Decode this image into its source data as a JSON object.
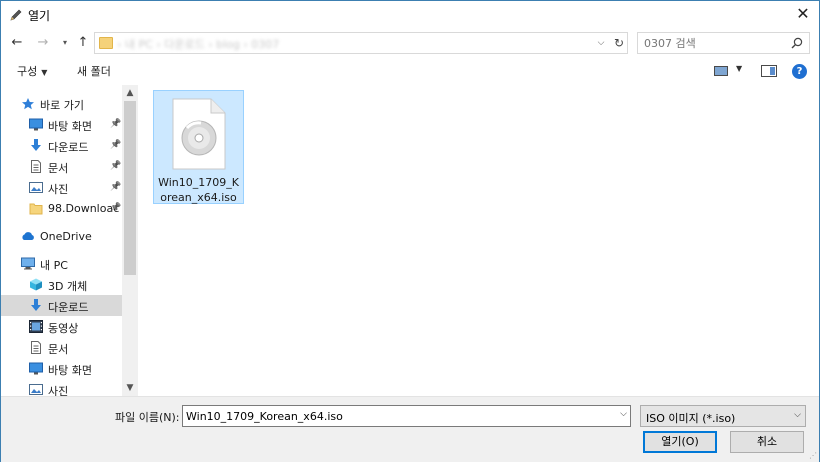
{
  "window": {
    "title": "열기"
  },
  "address": {
    "crumbs": "› 내 PC › 다운로드 › blog › 0307",
    "search_placeholder": "0307 검색"
  },
  "toolbar": {
    "organize_label": "구성",
    "new_folder_label": "새 폴더"
  },
  "nav": {
    "items": [
      {
        "label": "바로 가기",
        "icon": "star-icon",
        "pinned": false
      },
      {
        "label": "바탕 화면",
        "icon": "desktop-icon",
        "pinned": true
      },
      {
        "label": "다운로드",
        "icon": "download-icon",
        "pinned": true
      },
      {
        "label": "문서",
        "icon": "document-icon",
        "pinned": true
      },
      {
        "label": "사진",
        "icon": "pictures-icon",
        "pinned": true
      },
      {
        "label": "98.Downloac",
        "icon": "folder-icon",
        "pinned": true
      },
      {
        "label": "OneDrive",
        "icon": "cloud-icon",
        "pinned": false
      },
      {
        "label": "내 PC",
        "icon": "pc-icon",
        "pinned": false
      },
      {
        "label": "3D 개체",
        "icon": "cube-icon",
        "pinned": false
      },
      {
        "label": "다운로드",
        "icon": "download-icon",
        "pinned": false,
        "selected": true
      },
      {
        "label": "동영상",
        "icon": "video-icon",
        "pinned": false
      },
      {
        "label": "문서",
        "icon": "document-icon",
        "pinned": false
      },
      {
        "label": "바탕 화면",
        "icon": "desktop-icon",
        "pinned": false
      },
      {
        "label": "사진",
        "icon": "pictures-icon",
        "pinned": false
      }
    ]
  },
  "files": [
    {
      "name": "Win10_1709_Korean_x64.iso",
      "icon": "disc-image-icon",
      "selected": true
    }
  ],
  "footer": {
    "filename_label": "파일 이름(N):",
    "filename_value": "Win10_1709_Korean_x64.iso",
    "filetype_value": "ISO 이미지 (*.iso)",
    "open_label": "열기(O)",
    "cancel_label": "취소"
  },
  "colors": {
    "accent": "#0078d7",
    "selection": "#cce8ff",
    "nav_selected": "#d9d9d9"
  }
}
